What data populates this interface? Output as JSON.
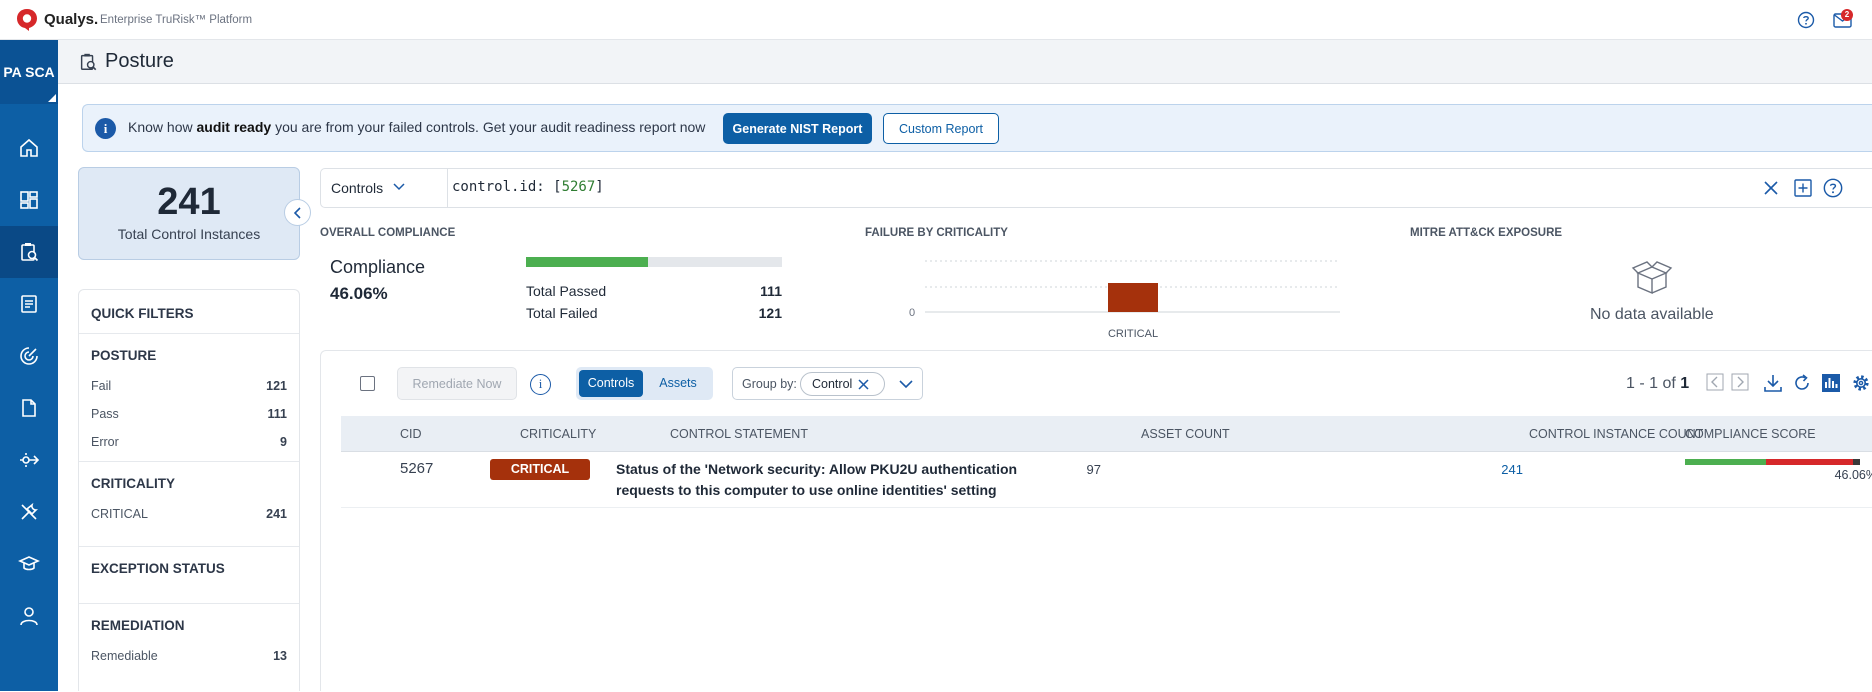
{
  "app": {
    "brand": "Qualys.",
    "platform": "Enterprise TruRisk™ Platform",
    "app_code": "PA SCA",
    "notifications": "2"
  },
  "header": {
    "title": "Posture"
  },
  "banner": {
    "text_prefix": "Know how",
    "text_bold": "audit ready",
    "text_suffix": "you are from your failed controls. Get your audit readiness report now",
    "nist_button": "Generate NIST Report",
    "custom_button": "Custom Report"
  },
  "summary": {
    "total": "241",
    "total_label": "Total Control Instances"
  },
  "quick_filters": {
    "title": "QUICK FILTERS",
    "posture": {
      "title": "POSTURE",
      "items": [
        {
          "label": "Fail",
          "count": "121"
        },
        {
          "label": "Pass",
          "count": "111"
        },
        {
          "label": "Error",
          "count": "9"
        }
      ]
    },
    "criticality": {
      "title": "CRITICALITY",
      "items": [
        {
          "label": "CRITICAL",
          "count": "241"
        }
      ]
    },
    "exception": {
      "title": "EXCEPTION STATUS"
    },
    "remediation": {
      "title": "REMEDIATION",
      "items": [
        {
          "label": "Remediable",
          "count": "13"
        }
      ]
    }
  },
  "search": {
    "scope": "Controls",
    "query_key": "control.id: [",
    "query_value": "5267",
    "query_close": "]"
  },
  "overall": {
    "title": "OVERALL COMPLIANCE",
    "label": "Compliance",
    "value": "46.06%",
    "passed_fraction": 0.4784,
    "passed_label": "Total Passed",
    "passed": "111",
    "failed_label": "Total Failed",
    "failed": "121"
  },
  "failure_chart": {
    "title": "FAILURE BY CRITICALITY",
    "chart_data": {
      "type": "bar",
      "categories": [
        "CRITICAL"
      ],
      "values": [
        121
      ],
      "y_tick_labels": [
        "0"
      ],
      "colors": [
        "#a5310c"
      ]
    }
  },
  "mitre": {
    "title": "MITRE ATT&CK EXPOSURE",
    "empty": "No data available"
  },
  "toolbar": {
    "remediate": "Remediate Now",
    "tab_controls": "Controls",
    "tab_assets": "Assets",
    "group_by_label": "Group by:",
    "group_by_value": "Control",
    "pager_range": "1 - 1 of",
    "pager_total": "1"
  },
  "table": {
    "columns": [
      "CID",
      "CRITICALITY",
      "CONTROL STATEMENT",
      "ASSET COUNT",
      "CONTROL INSTANCE COUNT",
      "COMPLIANCE SCORE"
    ],
    "rows": [
      {
        "cid": "5267",
        "criticality": "CRITICAL",
        "statement": "Status of the 'Network security: Allow PKU2U authentication requests to this computer to use online identities' setting",
        "asset_count": "97",
        "instance_count": "241",
        "score": "46.06%",
        "score_pass": 0.4606,
        "score_fail": 0.5
      }
    ]
  },
  "colors": {
    "brand": "#0d5fa5",
    "critical": "#a5310c",
    "pass": "#4caf50",
    "fail": "#d6282a"
  }
}
